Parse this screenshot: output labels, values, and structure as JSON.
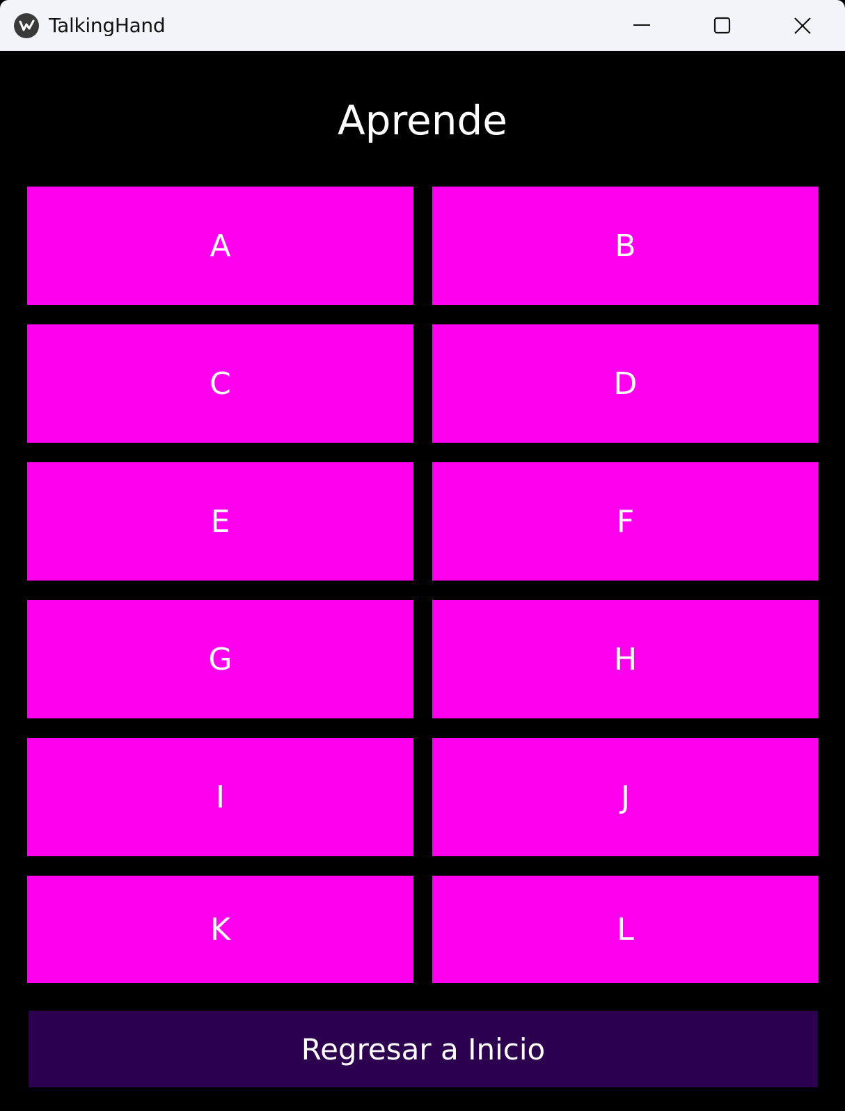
{
  "window": {
    "title": "TalkingHand",
    "icons": {
      "app": "app-logo-icon",
      "minimize": "minimize-icon",
      "maximize": "maximize-icon",
      "close": "close-icon"
    }
  },
  "main": {
    "heading": "Aprende",
    "letters": [
      "A",
      "B",
      "C",
      "D",
      "E",
      "F",
      "G",
      "H",
      "I",
      "J",
      "K",
      "L"
    ],
    "home_button": "Regresar a Inicio"
  },
  "colors": {
    "background": "#000000",
    "letter_button": "#ff00ee",
    "home_button": "#2d004f",
    "text": "#ffffff",
    "titlebar": "#f2f4f9"
  }
}
